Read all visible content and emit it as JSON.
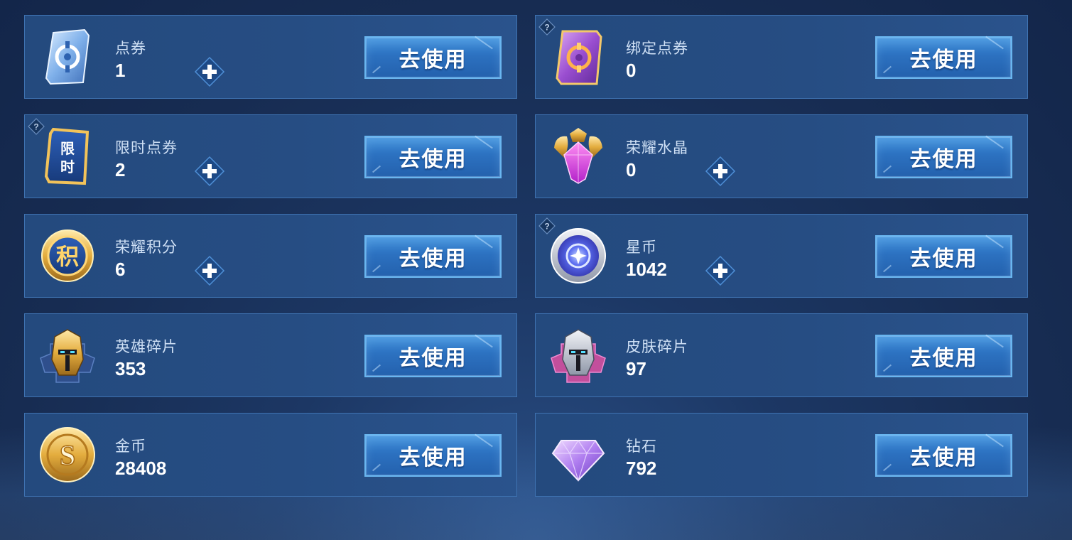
{
  "button_label": "去使用",
  "items": [
    {
      "label": "点券",
      "value": "1",
      "icon": "ticket-card-icon",
      "has_help": false,
      "has_plus": true
    },
    {
      "label": "绑定点券",
      "value": "0",
      "icon": "bound-ticket-card-icon",
      "has_help": true,
      "has_plus": false
    },
    {
      "label": "限时点券",
      "value": "2",
      "icon": "limited-time-ticket-icon",
      "has_help": true,
      "has_plus": true
    },
    {
      "label": "荣耀水晶",
      "value": "0",
      "icon": "glory-crystal-icon",
      "has_help": false,
      "has_plus": true
    },
    {
      "label": "荣耀积分",
      "value": "6",
      "icon": "glory-points-coin-icon",
      "has_help": false,
      "has_plus": true
    },
    {
      "label": "星币",
      "value": "1042",
      "icon": "star-coin-icon",
      "has_help": true,
      "has_plus": true
    },
    {
      "label": "英雄碎片",
      "value": "353",
      "icon": "hero-fragment-helmet-icon",
      "has_help": false,
      "has_plus": false
    },
    {
      "label": "皮肤碎片",
      "value": "97",
      "icon": "skin-fragment-helmet-icon",
      "has_help": false,
      "has_plus": false
    },
    {
      "label": "金币",
      "value": "28408",
      "icon": "gold-coin-icon",
      "has_help": false,
      "has_plus": false
    },
    {
      "label": "钻石",
      "value": "792",
      "icon": "diamond-icon",
      "has_help": false,
      "has_plus": false
    }
  ],
  "icon_glyphs": {
    "limited": "限时",
    "points": "积"
  }
}
